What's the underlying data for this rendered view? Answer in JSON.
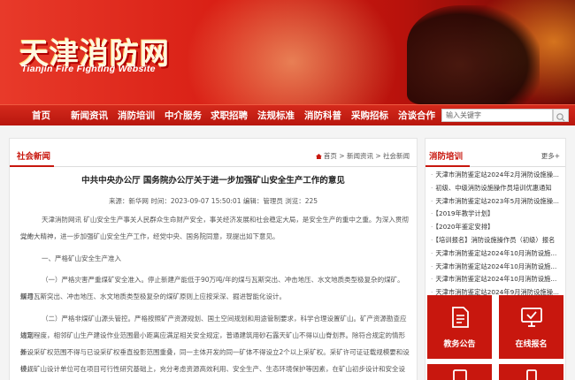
{
  "header": {
    "logo_cn": "天津消防网",
    "logo_en": "Tianjin Fire Fighting Website"
  },
  "nav": {
    "items": [
      "首页",
      "新闻资讯",
      "消防培训",
      "中介服务",
      "求职招聘",
      "法规标准",
      "消防科普",
      "采购招标",
      "洽谈合作"
    ],
    "search_placeholder": "输入关键字"
  },
  "content": {
    "section_title": "社会新闻",
    "breadcrumb": "首页 > 新闻资讯 > 社会新闻",
    "article_title": "中共中央办公厅 国务院办公厅关于进一步加强矿山安全生产工作的意见",
    "meta": "来源：新华网    时间：2023-09-07 15:50:01    编辑：管理员    浏览：225",
    "paragraphs": [
      "天津消防网讯 矿山安全生产事关人民群众生命财产安全，事关经济发展和社会稳定大局，是安全生产的重中之重。为深入贯彻党的",
      "二十大精神，进一步加强矿山安全生产工作，经党中央、国务院同意，现提出如下意见。",
      "一、严格矿山安全生产准入",
      "（一）严格灾害严重煤矿安全准入。停止新建产能低于90万吨/年的煤与瓦斯突出、冲击地压、水文地质类型极复杂的煤矿。新建",
      "煤与瓦斯突出、冲击地压、水文地质类型极复杂的煤矿原则上应按采深、掘进智能化设计。",
      "（二）严格非煤矿山源头管控。严格按照矿产资源规划、国土空间规划和用途管制要求，科学合理设置矿山。矿产资源勘查应达到",
      "规定程度，相邻矿山生产建设作业范围最小距离应满足相关安全规定，普通建筑用砂石露天矿山不得以山脊划界。除符合规定的情形外，",
      "新设采矿权范围不得与已设采矿权垂直投影范围重叠，同一主体开发的同一矿体不得设立2个以上采矿权。采矿许可证证载规模要和设计规",
      "模，矿山设计单位可在项目可行性研究基础上，充分考虑资源高效利用、安全生产、生态环境保护等因素，在矿山初步设计和安全设施设"
    ]
  },
  "sidebar": {
    "title": "消防培训",
    "more": "更多+",
    "items": [
      "天津市消防鉴定站2024年2月消防设施操...",
      "初级、中级消防设施操作员培训优惠通知",
      "天津市消防鉴定站2023年5月消防设施操...",
      "【2019年教学计划】",
      "【2020年鉴定安排】",
      "【培训报名】消防设施操作员（初级）报名",
      "天津市消防鉴定站2024年10月消防设施...",
      "天津市消防鉴定站2024年10月消防设施...",
      "天津市消防鉴定站2024年10月消防设施...",
      "天津市消防鉴定站2024年9月消防设施操..."
    ],
    "tiles": [
      {
        "label": "教务公告",
        "icon": "document-icon"
      },
      {
        "label": "在线报名",
        "icon": "monitor-check-icon"
      },
      {
        "label": "",
        "icon": "tablet-icon"
      },
      {
        "label": "",
        "icon": "phone-icon"
      }
    ]
  },
  "colors": {
    "brand_red": "#c8170e",
    "nav_red": "#c41f14"
  }
}
